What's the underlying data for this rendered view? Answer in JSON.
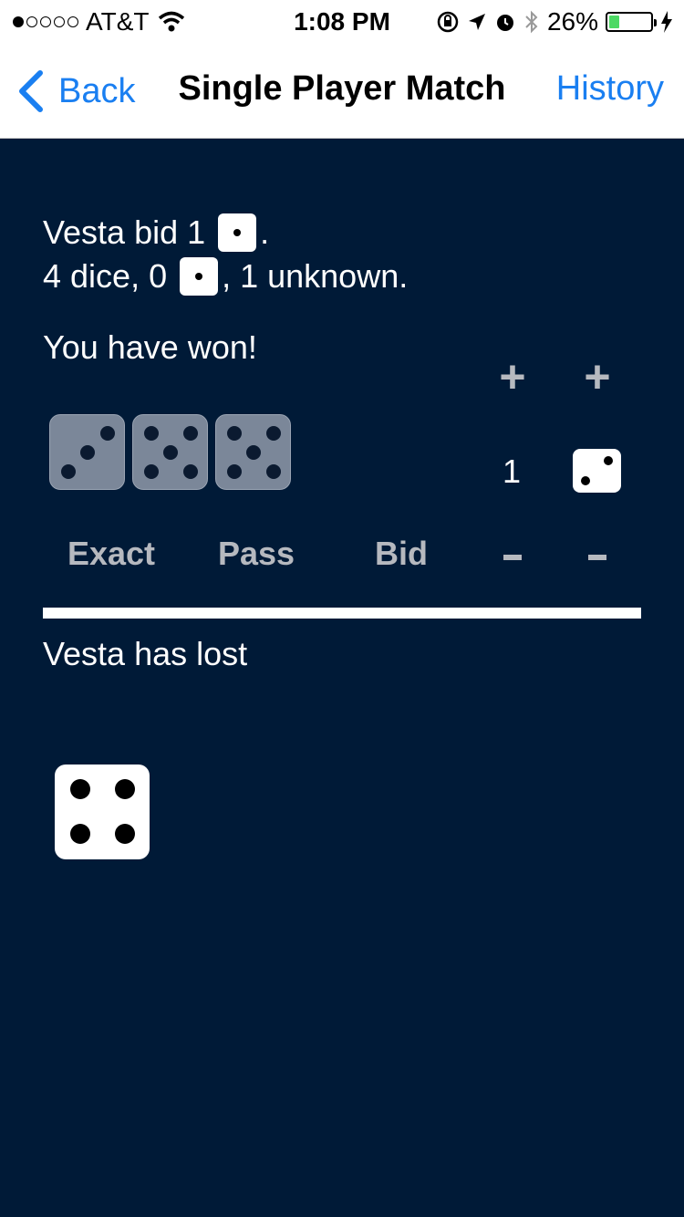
{
  "status_bar": {
    "carrier": "AT&T",
    "time": "1:08 PM",
    "battery": "26%",
    "battery_level": 0.26,
    "signal_bars_filled": 1,
    "signal_bars_total": 5
  },
  "nav": {
    "back_label": "Back",
    "title": "Single Player Match",
    "history_label": "History"
  },
  "game": {
    "bid_prefix": "Vesta bid 1",
    "bid_suffix": ".",
    "count_prefix": "4 dice, 0",
    "count_suffix": ", 1 unknown.",
    "result": "You have won!",
    "bid_count": "1",
    "bid_face": 2,
    "player_dice": [
      3,
      5,
      5
    ],
    "opponent_result": "Vesta has lost",
    "opponent_dice": [
      4
    ]
  },
  "controls": {
    "exact": "Exact",
    "pass": "Pass",
    "bid": "Bid",
    "plus": "+",
    "minus": "-"
  },
  "colors": {
    "background": "#001a37",
    "accent": "#1a7ff1",
    "disabled": "#b6b9bf"
  }
}
